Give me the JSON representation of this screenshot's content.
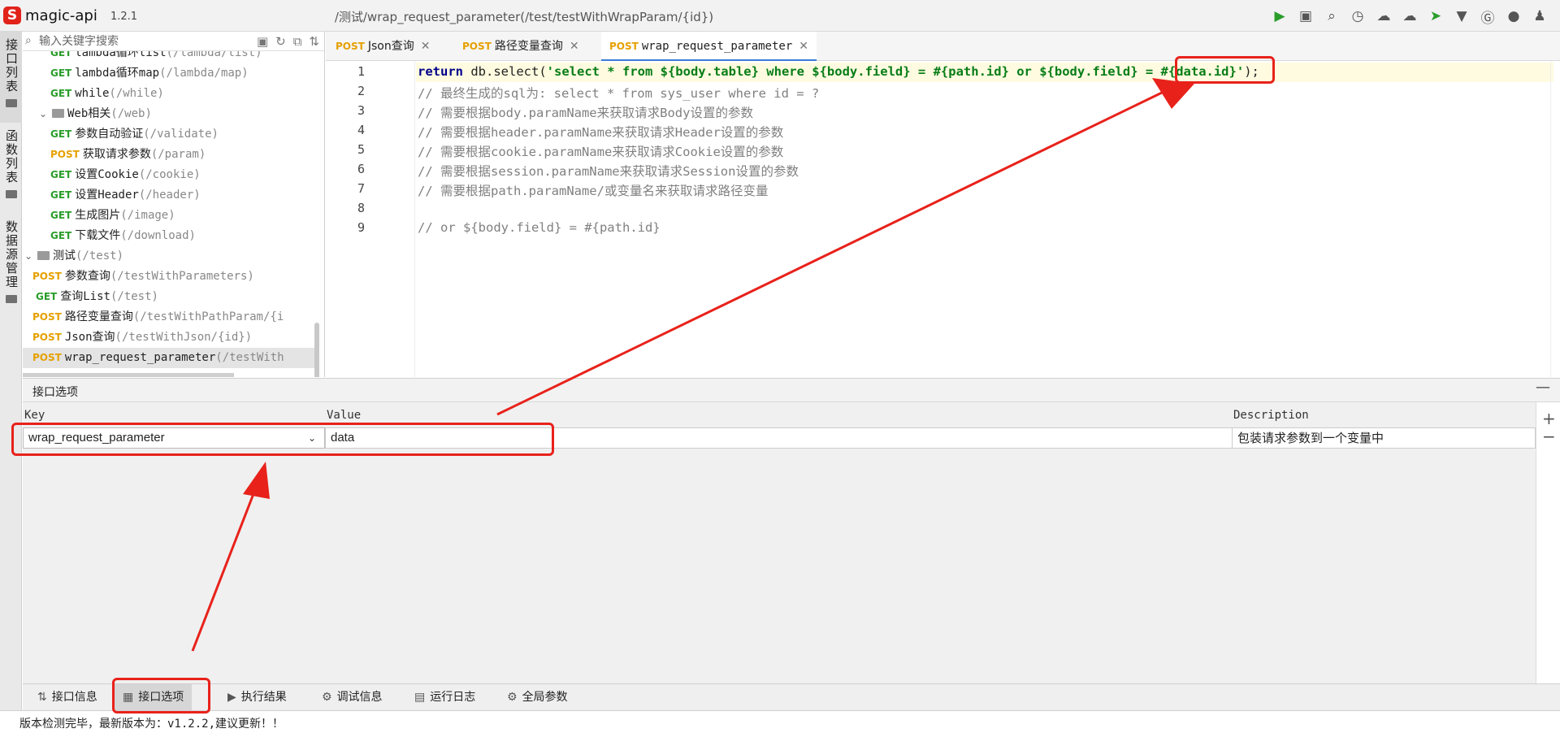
{
  "app": {
    "name": "magic-api",
    "version": "1.2.1",
    "window_path": "/测试/wrap_request_parameter(/test/testWithWrapParam/{id})"
  },
  "toolbar_icons": [
    "run-icon",
    "save-icon",
    "search-icon",
    "history-icon",
    "upload-icon",
    "download-icon",
    "push-icon",
    "skin-icon",
    "gitee-icon",
    "github-icon",
    "qq-icon"
  ],
  "left_tabs": [
    {
      "label": "接口列表"
    },
    {
      "label": "函数列表"
    },
    {
      "label": "数据源管理"
    }
  ],
  "search": {
    "placeholder": "输入关键字搜索"
  },
  "tree": [
    {
      "method": "GET",
      "name": "lambda循环list",
      "path": "(/lambda/list)"
    },
    {
      "method": "GET",
      "name": "lambda循环map",
      "path": "(/lambda/map)"
    },
    {
      "method": "GET",
      "name": "while",
      "path": "(/while)"
    },
    {
      "folder": true,
      "name": "Web相关",
      "path": "(/web)"
    },
    {
      "method": "GET",
      "name": "参数自动验证",
      "path": "(/validate)"
    },
    {
      "method": "POST",
      "name": "获取请求参数",
      "path": "(/param)"
    },
    {
      "method": "GET",
      "name": "设置Cookie",
      "path": "(/cookie)"
    },
    {
      "method": "GET",
      "name": "设置Header",
      "path": "(/header)"
    },
    {
      "method": "GET",
      "name": "生成图片",
      "path": "(/image)"
    },
    {
      "method": "GET",
      "name": "下载文件",
      "path": "(/download)"
    },
    {
      "folder": true,
      "name": "测试",
      "path": "(/test)"
    },
    {
      "method": "POST",
      "name": "参数查询",
      "path": "(/testWithParameters)"
    },
    {
      "method": "GET",
      "name": "查询List",
      "path": "(/test)"
    },
    {
      "method": "POST",
      "name": "路径变量查询",
      "path": "(/testWithPathParam/{i"
    },
    {
      "method": "POST",
      "name": "Json查询",
      "path": "(/testWithJson/{id})"
    },
    {
      "method": "POST",
      "name": "wrap_request_parameter",
      "path": "(/testWith"
    }
  ],
  "editor_tabs": [
    {
      "method": "POST",
      "label": "Json查询"
    },
    {
      "method": "POST",
      "label": "路径变量查询"
    },
    {
      "method": "POST",
      "label": "wrap_request_parameter"
    }
  ],
  "code": {
    "line_numbers": [
      "1",
      "2",
      "3",
      "4",
      "5",
      "6",
      "7",
      "8",
      "9"
    ],
    "l1_kw": "return",
    "l1_a": " db.select(",
    "l1_str": "'select * from ${body.table} where ${body.field} = #{path.id} or ${body.field} = #{data.id}'",
    "l1_end": ");",
    "l2": "// 最终生成的sql为: select * from sys_user where id = ?",
    "l3": "// 需要根据body.paramName来获取请求Body设置的参数",
    "l4": "// 需要根据header.paramName来获取请求Header设置的参数",
    "l5": "// 需要根据cookie.paramName来获取请求Cookie设置的参数",
    "l6": "// 需要根据session.paramName来获取请求Session设置的参数",
    "l7": "// 需要根据path.paramName/或变量名来获取请求路径变量",
    "l9": "// or ${body.field} = #{path.id}"
  },
  "options": {
    "title": "接口选项",
    "col_key": "Key",
    "col_value": "Value",
    "col_desc": "Description",
    "row": {
      "key": "wrap_request_parameter",
      "value": "data",
      "description": "包装请求参数到一个变量中"
    }
  },
  "bottom_tabs": [
    {
      "icon": "info-icon",
      "glyph": "⇅",
      "label": "接口信息"
    },
    {
      "icon": "options-icon",
      "glyph": "▦",
      "label": "接口选项"
    },
    {
      "icon": "play-icon",
      "glyph": "▶",
      "label": "执行结果"
    },
    {
      "icon": "debug-icon",
      "glyph": "⚙",
      "label": "调试信息"
    },
    {
      "icon": "log-icon",
      "glyph": "▤",
      "label": "运行日志"
    },
    {
      "icon": "gear-icon",
      "glyph": "⚙",
      "label": "全局参数"
    }
  ],
  "status": {
    "text": "版本检测完毕，最新版本为：v1.2.2,建议更新！！"
  },
  "colors": {
    "annotation": "#e8221b",
    "get": "#2a9d2a",
    "post": "#e6a000",
    "accent": "#3a7bd5"
  }
}
